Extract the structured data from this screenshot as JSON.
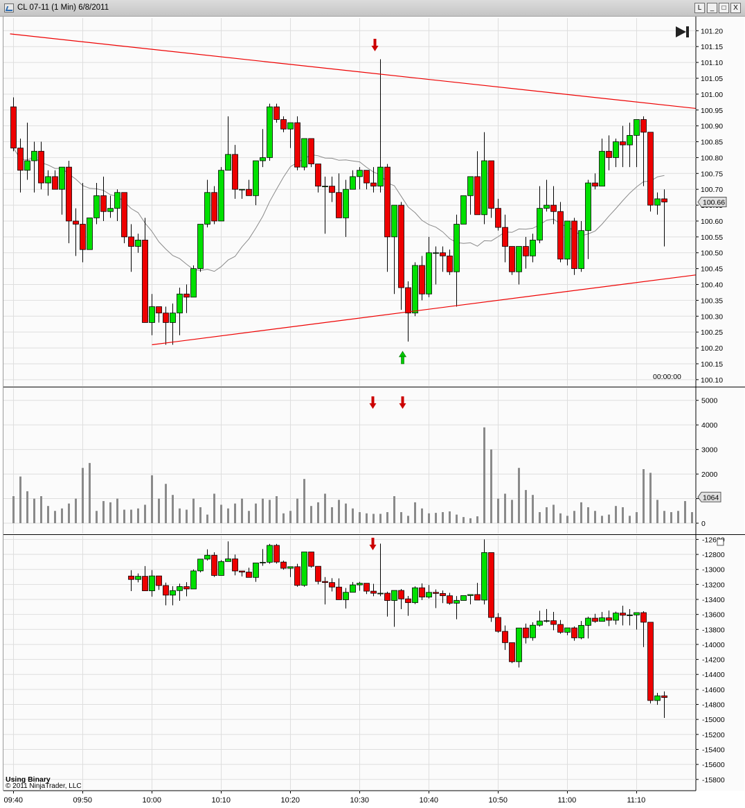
{
  "window": {
    "title": "CL 07-11 (1 Min)  6/8/2011",
    "buttons": [
      "L",
      "_",
      "□",
      "X"
    ]
  },
  "price_panel": {
    "time_remaining": "00:00:00",
    "current_price": "100.66",
    "go_to_end_icon": "skip-to-end-icon"
  },
  "volume_panel": {
    "current_volume": "1064"
  },
  "footer": {
    "label": "Using Binary",
    "copyright": "© 2011 NinjaTrader, LLC"
  },
  "colors": {
    "up": "#00e000",
    "down": "#ee0000",
    "trendline": "#ee0000",
    "sma": "#8a8a8a",
    "volume": "#8a8a8a",
    "arrow_down": "#cc0000",
    "arrow_up": "#00cc00"
  },
  "chart_data": [
    {
      "type": "candlestick",
      "panel": "price",
      "y_ticks": [
        "100.10",
        "100.15",
        "100.20",
        "100.25",
        "100.30",
        "100.35",
        "100.40",
        "100.45",
        "100.50",
        "100.55",
        "100.60",
        "100.65",
        "100.70",
        "100.75",
        "100.80",
        "100.85",
        "100.90",
        "100.95",
        "101.00",
        "101.05",
        "101.10",
        "101.15",
        "101.20"
      ],
      "ylim": [
        100.08,
        101.24
      ],
      "x_ticks": [
        {
          "label": "09:40",
          "bar": 0
        },
        {
          "label": "09:50",
          "bar": 10
        },
        {
          "label": "10:00",
          "bar": 20
        },
        {
          "label": "10:10",
          "bar": 30
        },
        {
          "label": "10:20",
          "bar": 40
        },
        {
          "label": "10:30",
          "bar": 50
        },
        {
          "label": "10:40",
          "bar": 60
        },
        {
          "label": "10:50",
          "bar": 70
        },
        {
          "label": "11:00",
          "bar": 80
        },
        {
          "label": "11:10",
          "bar": 90
        }
      ],
      "ohlc": [
        [
          100.96,
          100.99,
          100.82,
          100.83
        ],
        [
          100.83,
          100.86,
          100.69,
          100.76
        ],
        [
          100.76,
          100.91,
          100.73,
          100.79
        ],
        [
          100.79,
          100.85,
          100.69,
          100.82
        ],
        [
          100.82,
          100.85,
          100.7,
          100.72
        ],
        [
          100.72,
          100.76,
          100.68,
          100.74
        ],
        [
          100.74,
          100.76,
          100.7,
          100.7
        ],
        [
          100.7,
          100.77,
          100.62,
          100.77
        ],
        [
          100.77,
          100.79,
          100.53,
          100.6
        ],
        [
          100.6,
          100.64,
          100.49,
          100.59
        ],
        [
          100.59,
          100.72,
          100.47,
          100.51
        ],
        [
          100.51,
          100.61,
          100.51,
          100.61
        ],
        [
          100.61,
          100.72,
          100.59,
          100.68
        ],
        [
          100.68,
          100.74,
          100.6,
          100.63
        ],
        [
          100.63,
          100.68,
          100.61,
          100.64
        ],
        [
          100.64,
          100.7,
          100.6,
          100.69
        ],
        [
          100.69,
          100.69,
          100.53,
          100.55
        ],
        [
          100.55,
          100.59,
          100.44,
          100.52
        ],
        [
          100.52,
          100.56,
          100.5,
          100.54
        ],
        [
          100.54,
          100.61,
          100.3,
          100.28
        ],
        [
          100.28,
          100.37,
          100.24,
          100.33
        ],
        [
          100.33,
          100.33,
          100.28,
          100.31
        ],
        [
          100.31,
          100.33,
          100.21,
          100.28
        ],
        [
          100.28,
          100.34,
          100.21,
          100.31
        ],
        [
          100.31,
          100.39,
          100.24,
          100.37
        ],
        [
          100.37,
          100.4,
          100.31,
          100.36
        ],
        [
          100.36,
          100.46,
          100.36,
          100.45
        ],
        [
          100.45,
          100.59,
          100.44,
          100.59
        ],
        [
          100.59,
          100.73,
          100.58,
          100.69
        ],
        [
          100.69,
          100.71,
          100.59,
          100.6
        ],
        [
          100.6,
          100.77,
          100.6,
          100.76
        ],
        [
          100.76,
          100.93,
          100.76,
          100.81
        ],
        [
          100.81,
          100.84,
          100.67,
          100.7
        ],
        [
          100.7,
          100.7,
          100.67,
          100.7
        ],
        [
          100.7,
          100.73,
          100.68,
          100.68
        ],
        [
          100.68,
          100.77,
          100.65,
          100.79
        ],
        [
          100.79,
          100.89,
          100.77,
          100.8
        ],
        [
          100.8,
          100.97,
          100.79,
          100.96
        ],
        [
          100.96,
          100.97,
          100.91,
          100.92
        ],
        [
          100.92,
          100.93,
          100.88,
          100.89
        ],
        [
          100.89,
          100.91,
          100.83,
          100.91
        ],
        [
          100.91,
          100.93,
          100.76,
          100.77
        ],
        [
          100.77,
          100.86,
          100.76,
          100.86
        ],
        [
          100.86,
          100.86,
          100.77,
          100.78
        ],
        [
          100.78,
          100.78,
          100.69,
          100.71
        ],
        [
          100.71,
          100.74,
          100.56,
          100.71
        ],
        [
          100.71,
          100.74,
          100.66,
          100.69
        ],
        [
          100.69,
          100.75,
          100.61,
          100.61
        ],
        [
          100.61,
          100.73,
          100.55,
          100.7
        ],
        [
          100.7,
          100.76,
          100.7,
          100.74
        ],
        [
          100.74,
          100.77,
          100.7,
          100.76
        ],
        [
          100.76,
          100.75,
          100.7,
          100.72
        ],
        [
          100.72,
          100.77,
          100.69,
          100.71
        ],
        [
          100.71,
          101.11,
          100.69,
          100.77
        ],
        [
          100.77,
          100.78,
          100.44,
          100.55
        ],
        [
          100.55,
          100.58,
          100.37,
          100.65
        ],
        [
          100.65,
          100.66,
          100.32,
          100.39
        ],
        [
          100.39,
          100.41,
          100.22,
          100.31
        ],
        [
          100.31,
          100.47,
          100.3,
          100.46
        ],
        [
          100.46,
          100.49,
          100.35,
          100.37
        ],
        [
          100.37,
          100.55,
          100.36,
          100.5
        ]
      ],
      "ohlc_note": "approximate values read from chart",
      "ohlc_tail": [
        [
          100.5,
          100.52,
          100.4,
          100.5
        ],
        [
          100.5,
          100.52,
          100.44,
          100.49
        ],
        [
          100.49,
          100.51,
          100.43,
          100.44
        ],
        [
          100.44,
          100.62,
          100.33,
          100.59
        ],
        [
          100.59,
          100.67,
          100.59,
          100.68
        ],
        [
          100.68,
          100.74,
          100.62,
          100.74
        ],
        [
          100.74,
          100.82,
          100.66,
          100.62
        ],
        [
          100.62,
          100.88,
          100.59,
          100.79
        ],
        [
          100.79,
          100.76,
          100.61,
          100.64
        ],
        [
          100.64,
          100.67,
          100.57,
          100.58
        ],
        [
          100.58,
          100.62,
          100.47,
          100.52
        ],
        [
          100.52,
          100.52,
          100.43,
          100.44
        ],
        [
          100.44,
          100.51,
          100.4,
          100.52
        ],
        [
          100.52,
          100.55,
          100.45,
          100.49
        ],
        [
          100.49,
          100.56,
          100.47,
          100.54
        ],
        [
          100.54,
          100.71,
          100.53,
          100.64
        ],
        [
          100.64,
          100.73,
          100.63,
          100.65
        ],
        [
          100.65,
          100.71,
          100.59,
          100.63
        ],
        [
          100.63,
          100.66,
          100.47,
          100.48
        ],
        [
          100.48,
          100.6,
          100.46,
          100.6
        ],
        [
          100.6,
          100.61,
          100.43,
          100.45
        ],
        [
          100.45,
          100.6,
          100.44,
          100.57
        ],
        [
          100.57,
          100.73,
          100.48,
          100.72
        ],
        [
          100.72,
          100.75,
          100.7,
          100.71
        ],
        [
          100.71,
          100.86,
          100.71,
          100.82
        ],
        [
          100.82,
          100.87,
          100.76,
          100.8
        ],
        [
          100.8,
          100.86,
          100.77,
          100.85
        ],
        [
          100.85,
          100.9,
          100.77,
          100.84
        ],
        [
          100.84,
          100.91,
          100.77,
          100.87
        ],
        [
          100.87,
          100.91,
          100.77,
          100.92
        ],
        [
          100.92,
          100.93,
          100.71,
          100.88
        ],
        [
          100.88,
          100.76,
          100.63,
          100.65
        ],
        [
          100.65,
          100.69,
          100.62,
          100.67
        ],
        [
          100.67,
          100.7,
          100.52,
          100.66
        ]
      ],
      "trendlines": [
        {
          "from": [
            -0.5,
            101.19
          ],
          "to": [
            98.5,
            100.955
          ]
        },
        {
          "from": [
            20,
            100.21
          ],
          "to": [
            98.5,
            100.43
          ]
        }
      ],
      "sma_note": "moving average line",
      "arrows": [
        {
          "bar": 53,
          "dir": "down",
          "at": "top"
        },
        {
          "bar": 57,
          "dir": "up",
          "at": "bottom"
        }
      ]
    },
    {
      "type": "bar",
      "panel": "volume",
      "y_ticks": [
        "0",
        "1000",
        "2000",
        "3000",
        "4000",
        "5000"
      ],
      "ylim": [
        0,
        5500
      ],
      "values": [
        1100,
        1900,
        1300,
        1000,
        1100,
        700,
        500,
        600,
        800,
        1000,
        2250,
        2450,
        500,
        900,
        850,
        1000,
        550,
        550,
        600,
        750,
        1950,
        1000,
        1600,
        1150,
        600,
        550,
        1000,
        650,
        350,
        1200,
        750,
        600,
        800,
        1000,
        500,
        800,
        1000,
        950,
        1100,
        400,
        500,
        1000,
        1800,
        700,
        850,
        1200,
        650,
        950,
        800,
        600,
        450,
        400,
        380,
        380,
        450,
        1100,
        450,
        300,
        850,
        600,
        400,
        420,
        450,
        480,
        350,
        250,
        200,
        280,
        3900,
        3000,
        1000,
        1200,
        950,
        2250,
        1350,
        1150,
        450,
        650,
        750,
        400,
        300,
        500,
        850,
        650,
        500,
        300,
        350,
        700,
        650,
        300,
        450,
        2200,
        2050,
        950,
        500,
        450,
        500,
        900,
        450
      ],
      "arrows": [
        {
          "bar": 53,
          "dir": "down"
        },
        {
          "bar": 57,
          "dir": "down"
        }
      ]
    },
    {
      "type": "candlestick",
      "panel": "cumulative",
      "y_ticks": [
        "-12600",
        "-12800",
        "-13000",
        "-13200",
        "-13400",
        "-13600",
        "-13800",
        "-14000",
        "-14200",
        "-14400",
        "-14600",
        "-14800",
        "-15000",
        "-15200",
        "-15400",
        "-15600",
        "-15800"
      ],
      "ylim": [
        -15950,
        -12550
      ],
      "start_bar": 17,
      "arrows": [
        {
          "bar": 53,
          "dir": "down"
        }
      ]
    }
  ]
}
